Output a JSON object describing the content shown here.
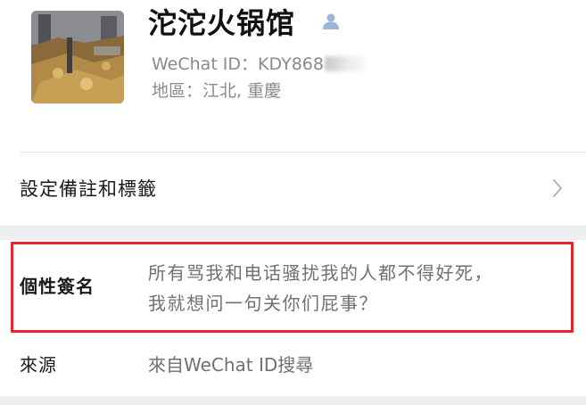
{
  "profile": {
    "name": "沱沱火锅馆",
    "wechat_id_label": "WeChat ID：",
    "wechat_id_visible": "KDY868",
    "region_label": "地區：",
    "region_value": "江北, 重慶"
  },
  "remark": {
    "label": "設定備註和標籤"
  },
  "signature": {
    "label": "個性簽名",
    "line1": "所有骂我和电话骚扰我的人都不得好死，",
    "line2": "我就想问一句关你们屁事？"
  },
  "source": {
    "label": "來源",
    "value": "來自WeChat ID搜尋"
  },
  "colors": {
    "highlight_border": "#e8232c",
    "secondary_text": "#8a8a8a",
    "page_band": "#efeff1",
    "user_icon": "#9bb6d6"
  },
  "icons": [
    "user-verified-icon",
    "chevron-right-icon"
  ]
}
